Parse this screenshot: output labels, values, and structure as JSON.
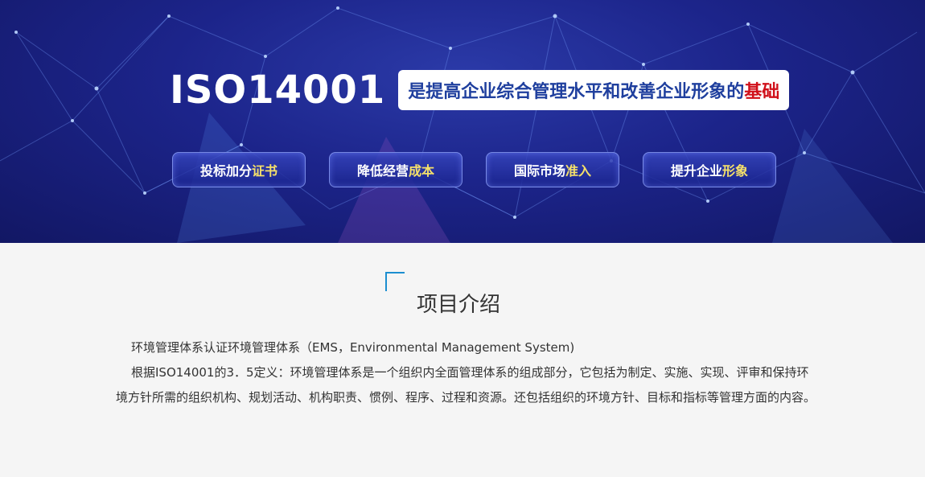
{
  "banner": {
    "headline": "ISO14001",
    "tagline_main": "是提高企业综合管理水平和改善企业形象的",
    "tagline_emphasis": "基础",
    "buttons": [
      {
        "text": "投标加分",
        "highlight": "证书"
      },
      {
        "text": "降低经营",
        "highlight": "成本"
      },
      {
        "text": "国际市场",
        "highlight": "准入"
      },
      {
        "text": "提升企业",
        "highlight": "形象"
      }
    ]
  },
  "section": {
    "title": "项目介绍",
    "paragraphs": [
      "环境管理体系认证环境管理体系（EMS，Environmental Management System)",
      "根据ISO14001的3．5定义：环境管理体系是一个组织内全面管理体系的组成部分，它包括为制定、实施、实现、评审和保持环境方针所需的组织机构、规划活动、机构职责、惯例、程序、过程和资源。还包括组织的环境方针、目标和指标等管理方面的内容。"
    ]
  },
  "colors": {
    "banner_bg": "#1c248a",
    "tagline_text": "#1f3f9e",
    "emphasis_red": "#d0101a",
    "button_highlight": "#f5e06a",
    "accent_blue": "#1c8ed0"
  }
}
